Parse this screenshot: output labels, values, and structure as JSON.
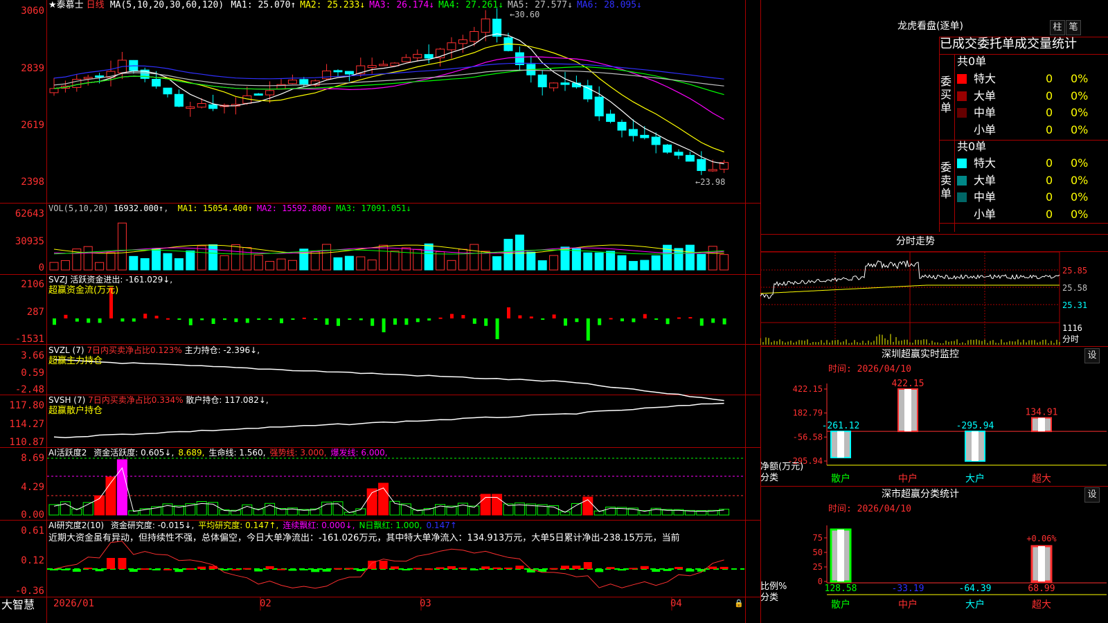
{
  "app_brand": "大智慧",
  "kline": {
    "title_star": "★",
    "stock_name": "泰慕士",
    "period": "日线",
    "ma_prefix": "MA(5,10,20,30,60,120)",
    "ma": [
      {
        "label": "MA1: 25.070↑",
        "color": "#ffffff"
      },
      {
        "label": "MA2: 25.233↓",
        "color": "#ffff00"
      },
      {
        "label": "MA3: 26.174↓",
        "color": "#ff00ff"
      },
      {
        "label": "MA4: 27.261↓",
        "color": "#00ff00"
      },
      {
        "label": "MA5: 27.577↓",
        "color": "#c0c0c0"
      },
      {
        "label": "MA6: 28.095↓",
        "color": "#3030ff"
      }
    ],
    "high_label": "30.60",
    "low_label": "23.98",
    "y_labels": [
      "3060",
      "2839",
      "2619",
      "2398"
    ]
  },
  "volume": {
    "header": "VOL(5,10,20)",
    "value": "16932.000↑",
    "ma": [
      {
        "label": "MA1: 15054.400↑",
        "color": "#ffff00"
      },
      {
        "label": "MA2: 15592.800↑",
        "color": "#ff00ff"
      },
      {
        "label": "MA3: 17091.051↓",
        "color": "#00ff00"
      }
    ],
    "y_labels": [
      "62643",
      "30935",
      "0"
    ]
  },
  "svzj": {
    "header": "SVZJ  活跃资金进出: -161.029↓,",
    "sub": "超赢资金流(万元)",
    "y_labels": [
      "2106",
      "287",
      "-1531"
    ]
  },
  "svzl": {
    "name": "SVZL (7)",
    "metric1": "7日内买卖净占比0.123%",
    "metric2": "主力持仓: -2.396↓,",
    "sub": "超赢主力持仓",
    "y_labels": [
      "3.66",
      "0.59",
      "-2.48"
    ]
  },
  "svsh": {
    "name": "SVSH (7)",
    "metric1": "7日内买卖净占比0.334%",
    "metric2": "散户持仓: 117.082↓,",
    "sub": "超赢散户持仓",
    "y_labels": [
      "117.80",
      "114.27",
      "110.87"
    ]
  },
  "ai_active": {
    "name": "AI活跃度2",
    "parts": [
      {
        "label": "资金活跃度: 0.605↓,",
        "color": "#ffffff"
      },
      {
        "label": "8.689,",
        "color": "#ffff00"
      },
      {
        "label": "生命线: 1.560,",
        "color": "#ffffff"
      },
      {
        "label": "强势线: 3.000,",
        "color": "#ff3030"
      },
      {
        "label": "爆发线: 6.000,",
        "color": "#ff00ff"
      }
    ],
    "y_labels": [
      "8.69",
      "4.29",
      "0.00"
    ]
  },
  "ai_research": {
    "name": "AI研究度2(10)",
    "parts": [
      {
        "label": "资金研究度: -0.015↓,",
        "color": "#ffffff"
      },
      {
        "label": "平均研究度: 0.147↑,",
        "color": "#ffff00"
      },
      {
        "label": "连续飘红: 0.000↓,",
        "color": "#ff00ff"
      },
      {
        "label": "N日飘红: 1.000,",
        "color": "#00ff00"
      },
      {
        "label": "0.147↑",
        "color": "#3030ff"
      }
    ],
    "comment": "近期大资金虽有异动，但持续性不强，总体偏空，今日大单净流出：-161.026万元，其中特大单净流入：134.913万元，大单5日累计净出-238.15万元，当前",
    "y_labels": [
      "0.61",
      "0.12",
      "-0.36"
    ]
  },
  "x_axis": {
    "labels": [
      "2026/01",
      "02",
      "03",
      "04"
    ]
  },
  "longhu": {
    "title": "龙虎看盘(逐单)",
    "btn_bar": "柱",
    "btn_pen": "笔",
    "header": "已成交委托单成交量统计",
    "buy": {
      "side": "委买单",
      "total": "共0单",
      "rows": [
        {
          "name": "特大",
          "vol": "0",
          "pct": "0%",
          "color": "#ff0000"
        },
        {
          "name": "大单",
          "vol": "0",
          "pct": "0%",
          "color": "#990000"
        },
        {
          "name": "中单",
          "vol": "0",
          "pct": "0%",
          "color": "#660000"
        },
        {
          "name": "小单",
          "vol": "0",
          "pct": "0%",
          "color": "#000000"
        }
      ]
    },
    "sell": {
      "side": "委卖单",
      "total": "共0单",
      "rows": [
        {
          "name": "特大",
          "vol": "0",
          "pct": "0%",
          "color": "#00ffff"
        },
        {
          "name": "大单",
          "vol": "0",
          "pct": "0%",
          "color": "#008888"
        },
        {
          "name": "中单",
          "vol": "0",
          "pct": "0%",
          "color": "#006666"
        },
        {
          "name": "小单",
          "vol": "0",
          "pct": "0%",
          "color": "#000000"
        }
      ]
    }
  },
  "intraday": {
    "title": "分时走势",
    "prices": [
      "25.85",
      "25.58",
      "25.31"
    ],
    "vol": "1116",
    "vol_unit": "分时"
  },
  "sz_monitor": {
    "title": "深圳超赢实时监控",
    "btn": "设",
    "time_label": "时间: 2026/04/10",
    "y_labels": [
      "422.15",
      "182.79",
      "-56.58",
      "-295.94"
    ],
    "y_caption1": "净额(万元)",
    "y_caption2": "分类",
    "categories": [
      "散户",
      "中户",
      "大户",
      "超大"
    ],
    "values": [
      -261.12,
      422.15,
      -295.94,
      134.91
    ],
    "value_labels": [
      "-261.12",
      "422.15",
      "-295.94",
      "134.91"
    ]
  },
  "sz_class": {
    "title": "深市超赢分类统计",
    "btn": "设",
    "time_label": "时间: 2026/04/10",
    "y_labels": [
      "75",
      "50",
      "25",
      "0"
    ],
    "y_caption1": "比例%",
    "y_caption2": "分类",
    "pct_label": "+0.06%",
    "categories": [
      "散户",
      "中户",
      "大户",
      "超大"
    ],
    "value_labels": [
      "128.58",
      "-33.19",
      "-64.39",
      "68.99"
    ],
    "value_colors": [
      "#00ff00",
      "#3030ff",
      "#00ffff",
      "#ff3030"
    ],
    "bar_levels": [
      1.0,
      0,
      0,
      0.68
    ]
  }
}
